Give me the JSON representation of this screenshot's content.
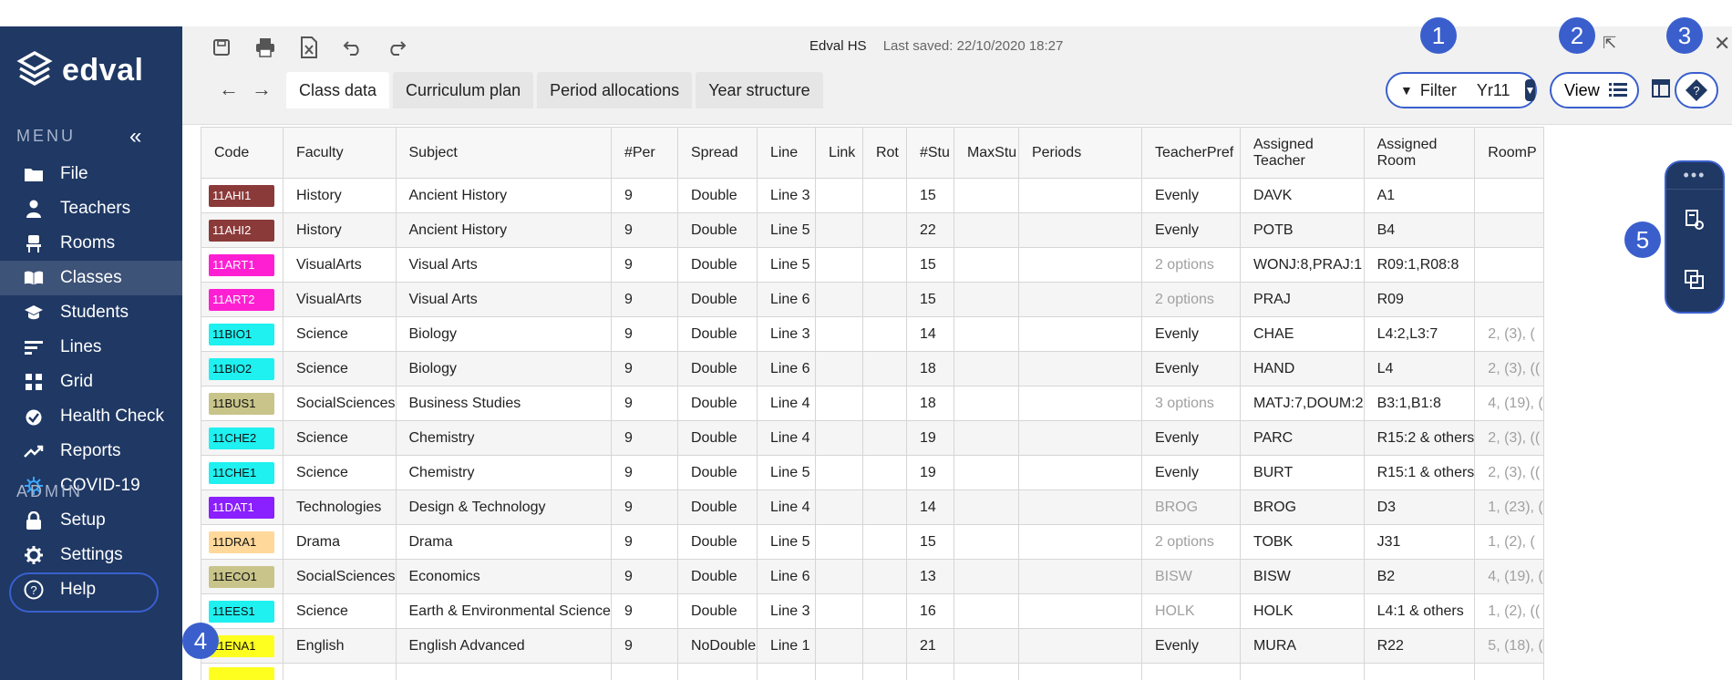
{
  "sidebar": {
    "logo_text": "edval",
    "menu_heading": "MENU",
    "admin_heading": "ADMIN",
    "items": [
      {
        "label": "File",
        "icon": "folder-icon"
      },
      {
        "label": "Teachers",
        "icon": "person-icon"
      },
      {
        "label": "Rooms",
        "icon": "chair-icon"
      },
      {
        "label": "Classes",
        "icon": "book-icon",
        "active": true
      },
      {
        "label": "Students",
        "icon": "mortarboard-icon"
      },
      {
        "label": "Lines",
        "icon": "lines-icon"
      },
      {
        "label": "Grid",
        "icon": "grid-icon"
      },
      {
        "label": "Health Check",
        "icon": "checkmark-icon"
      },
      {
        "label": "Reports",
        "icon": "trend-icon"
      },
      {
        "label": "COVID-19",
        "icon": "virus-icon"
      }
    ],
    "admin_items": [
      {
        "label": "Setup",
        "icon": "lock-icon"
      },
      {
        "label": "Settings",
        "icon": "gear-icon"
      },
      {
        "label": "Help",
        "icon": "question-icon"
      }
    ]
  },
  "toolbar": {
    "school": "Edval HS",
    "last_saved": "Last saved: 22/10/2020 18:27",
    "tabs": [
      "Class data",
      "Curriculum plan",
      "Period allocations",
      "Year structure"
    ],
    "filter_label": "Filter",
    "year_value": "Yr11",
    "view_label": "View"
  },
  "callouts": [
    "1",
    "2",
    "3",
    "4",
    "5"
  ],
  "table": {
    "columns": [
      "Code",
      "Faculty",
      "Subject",
      "#Per",
      "Spread",
      "Line",
      "Link",
      "Rot",
      "#Stu",
      "MaxStu",
      "Periods",
      "TeacherPref",
      "Assigned Teacher",
      "Assigned Room",
      "RoomP"
    ],
    "rows": [
      {
        "code": "11AHI1",
        "color": "#8b3a3a",
        "faculty": "History",
        "subject": "Ancient History",
        "per": "9",
        "spread": "Double",
        "line": "Line 3",
        "stu": "15",
        "pref": "Evenly",
        "pref_muted": false,
        "teacher": "DAVK",
        "room": "A1",
        "roomp": ""
      },
      {
        "code": "11AHI2",
        "color": "#8b3a3a",
        "faculty": "History",
        "subject": "Ancient History",
        "per": "9",
        "spread": "Double",
        "line": "Line 5",
        "stu": "22",
        "pref": "Evenly",
        "pref_muted": false,
        "teacher": "POTB",
        "room": "B4",
        "roomp": ""
      },
      {
        "code": "11ART1",
        "color": "#ff1fd2",
        "faculty": "VisualArts",
        "subject": "Visual Arts",
        "per": "9",
        "spread": "Double",
        "line": "Line 5",
        "stu": "15",
        "pref": "2 options",
        "pref_muted": true,
        "teacher": "WONJ:8,PRAJ:1",
        "room": "R09:1,R08:8",
        "roomp": ""
      },
      {
        "code": "11ART2",
        "color": "#ff1fd2",
        "faculty": "VisualArts",
        "subject": "Visual Arts",
        "per": "9",
        "spread": "Double",
        "line": "Line 6",
        "stu": "15",
        "pref": "2 options",
        "pref_muted": true,
        "teacher": "PRAJ",
        "room": "R09",
        "roomp": ""
      },
      {
        "code": "11BIO1",
        "color": "#1ff0f0",
        "faculty": "Science",
        "subject": "Biology",
        "per": "9",
        "spread": "Double",
        "line": "Line 3",
        "stu": "14",
        "pref": "Evenly",
        "pref_muted": false,
        "teacher": "CHAE",
        "room": "L4:2,L3:7",
        "roomp": "2, (3), ("
      },
      {
        "code": "11BIO2",
        "color": "#1ff0f0",
        "faculty": "Science",
        "subject": "Biology",
        "per": "9",
        "spread": "Double",
        "line": "Line 6",
        "stu": "18",
        "pref": "Evenly",
        "pref_muted": false,
        "teacher": "HAND",
        "room": "L4",
        "roomp": "2, (3), (("
      },
      {
        "code": "11BUS1",
        "color": "#c8c48a",
        "faculty": "SocialSciences",
        "subject": "Business Studies",
        "per": "9",
        "spread": "Double",
        "line": "Line 4",
        "stu": "18",
        "pref": "3 options",
        "pref_muted": true,
        "teacher": "MATJ:7,DOUM:2",
        "room": "B3:1,B1:8",
        "roomp": "4, (19), ("
      },
      {
        "code": "11CHE2",
        "color": "#1ff0f0",
        "faculty": "Science",
        "subject": "Chemistry",
        "per": "9",
        "spread": "Double",
        "line": "Line 4",
        "stu": "19",
        "pref": "Evenly",
        "pref_muted": false,
        "teacher": "PARC",
        "room": "R15:2 & others",
        "roomp": "2, (3), (("
      },
      {
        "code": "11CHE1",
        "color": "#1ff0f0",
        "faculty": "Science",
        "subject": "Chemistry",
        "per": "9",
        "spread": "Double",
        "line": "Line 5",
        "stu": "19",
        "pref": "Evenly",
        "pref_muted": false,
        "teacher": "BURT",
        "room": "R15:1 & others",
        "roomp": "2, (3), (("
      },
      {
        "code": "11DAT1",
        "color": "#8a1fff",
        "faculty": "Technologies",
        "subject": "Design & Technology",
        "per": "9",
        "spread": "Double",
        "line": "Line 4",
        "stu": "14",
        "pref": "BROG",
        "pref_muted": true,
        "teacher": "BROG",
        "room": "D3",
        "roomp": "1, (23), ("
      },
      {
        "code": "11DRA1",
        "color": "#ffd89a",
        "faculty": "Drama",
        "subject": "Drama",
        "per": "9",
        "spread": "Double",
        "line": "Line 5",
        "stu": "15",
        "pref": "2 options",
        "pref_muted": true,
        "teacher": "TOBK",
        "room": "J31",
        "roomp": "1, (2), ("
      },
      {
        "code": "11ECO1",
        "color": "#c8c48a",
        "faculty": "SocialSciences",
        "subject": "Economics",
        "per": "9",
        "spread": "Double",
        "line": "Line 6",
        "stu": "13",
        "pref": "BISW",
        "pref_muted": true,
        "teacher": "BISW",
        "room": "B2",
        "roomp": "4, (19), ("
      },
      {
        "code": "11EES1",
        "color": "#1ff0f0",
        "faculty": "Science",
        "subject": "Earth & Environmental Science",
        "per": "9",
        "spread": "Double",
        "line": "Line 3",
        "stu": "16",
        "pref": "HOLK",
        "pref_muted": true,
        "teacher": "HOLK",
        "room": "L4:1 & others",
        "roomp": "1, (2), (("
      },
      {
        "code": "11ENA1",
        "color": "#ffff1f",
        "faculty": "English",
        "subject": "English Advanced",
        "per": "9",
        "spread": "NoDouble",
        "line": "Line 1",
        "stu": "21",
        "pref": "Evenly",
        "pref_muted": false,
        "teacher": "MURA",
        "room": "R22",
        "roomp": "5, (18), ("
      },
      {
        "code": "",
        "color": "#ffff1f",
        "faculty": "",
        "subject": "",
        "per": "",
        "spread": "",
        "line": "",
        "stu": "",
        "pref": "",
        "pref_muted": false,
        "teacher": "",
        "room": "",
        "roomp": ""
      }
    ]
  }
}
